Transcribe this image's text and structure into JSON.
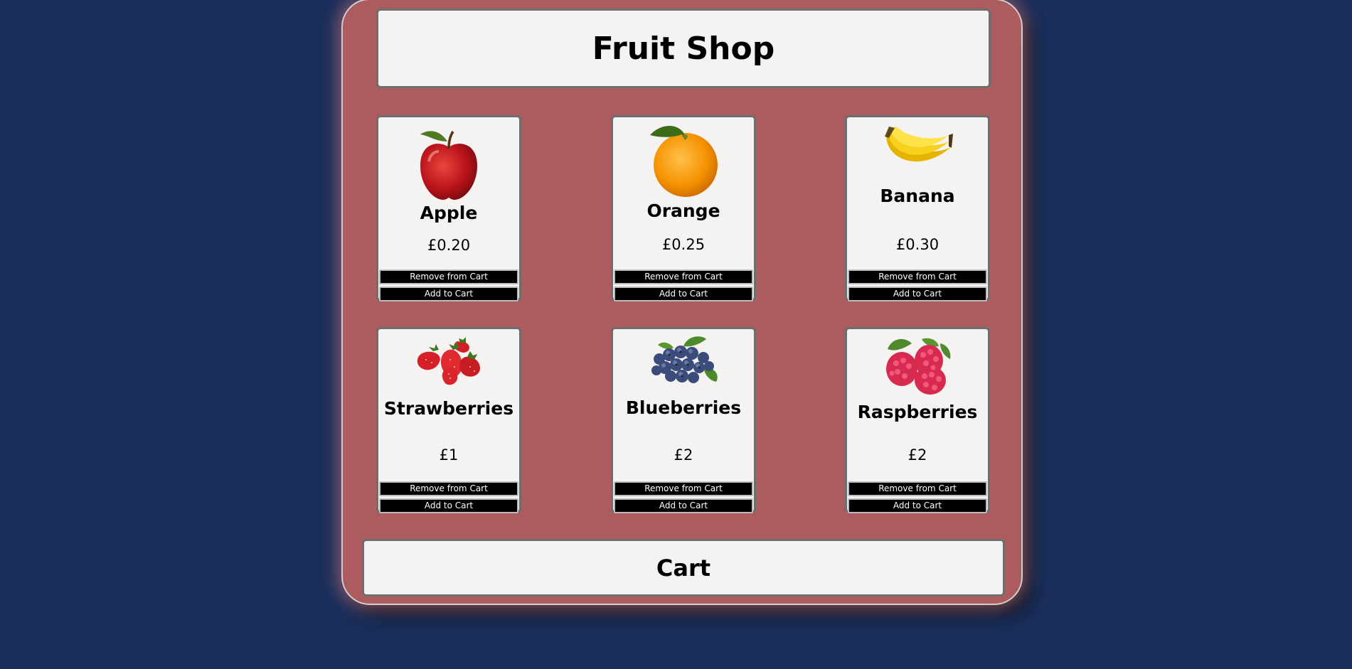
{
  "shop": {
    "title": "Fruit Shop",
    "products": [
      {
        "name": "Apple",
        "price": "£0.20",
        "remove_label": "Remove from Cart",
        "add_label": "Add to Cart"
      },
      {
        "name": "Orange",
        "price": "£0.25",
        "remove_label": "Remove from Cart",
        "add_label": "Add to Cart"
      },
      {
        "name": "Banana",
        "price": "£0.30",
        "remove_label": "Remove from Cart",
        "add_label": "Add to Cart"
      },
      {
        "name": "Strawberries",
        "price": "£1",
        "remove_label": "Remove from Cart",
        "add_label": "Add to Cart"
      },
      {
        "name": "Blueberries",
        "price": "£2",
        "remove_label": "Remove from Cart",
        "add_label": "Add to Cart"
      },
      {
        "name": "Raspberries",
        "price": "£2",
        "remove_label": "Remove from Cart",
        "add_label": "Add to Cart"
      }
    ],
    "cart_title": "Cart"
  },
  "colors": {
    "page_background": "#1a2e5a",
    "shop_background": "#ac5c5e",
    "panel_background": "#f5f3f1",
    "button_background": "#000000",
    "button_text": "#ffffff"
  },
  "icons": [
    "apple-icon",
    "orange-icon",
    "banana-icon",
    "strawberries-icon",
    "blueberries-icon",
    "raspberries-icon"
  ]
}
